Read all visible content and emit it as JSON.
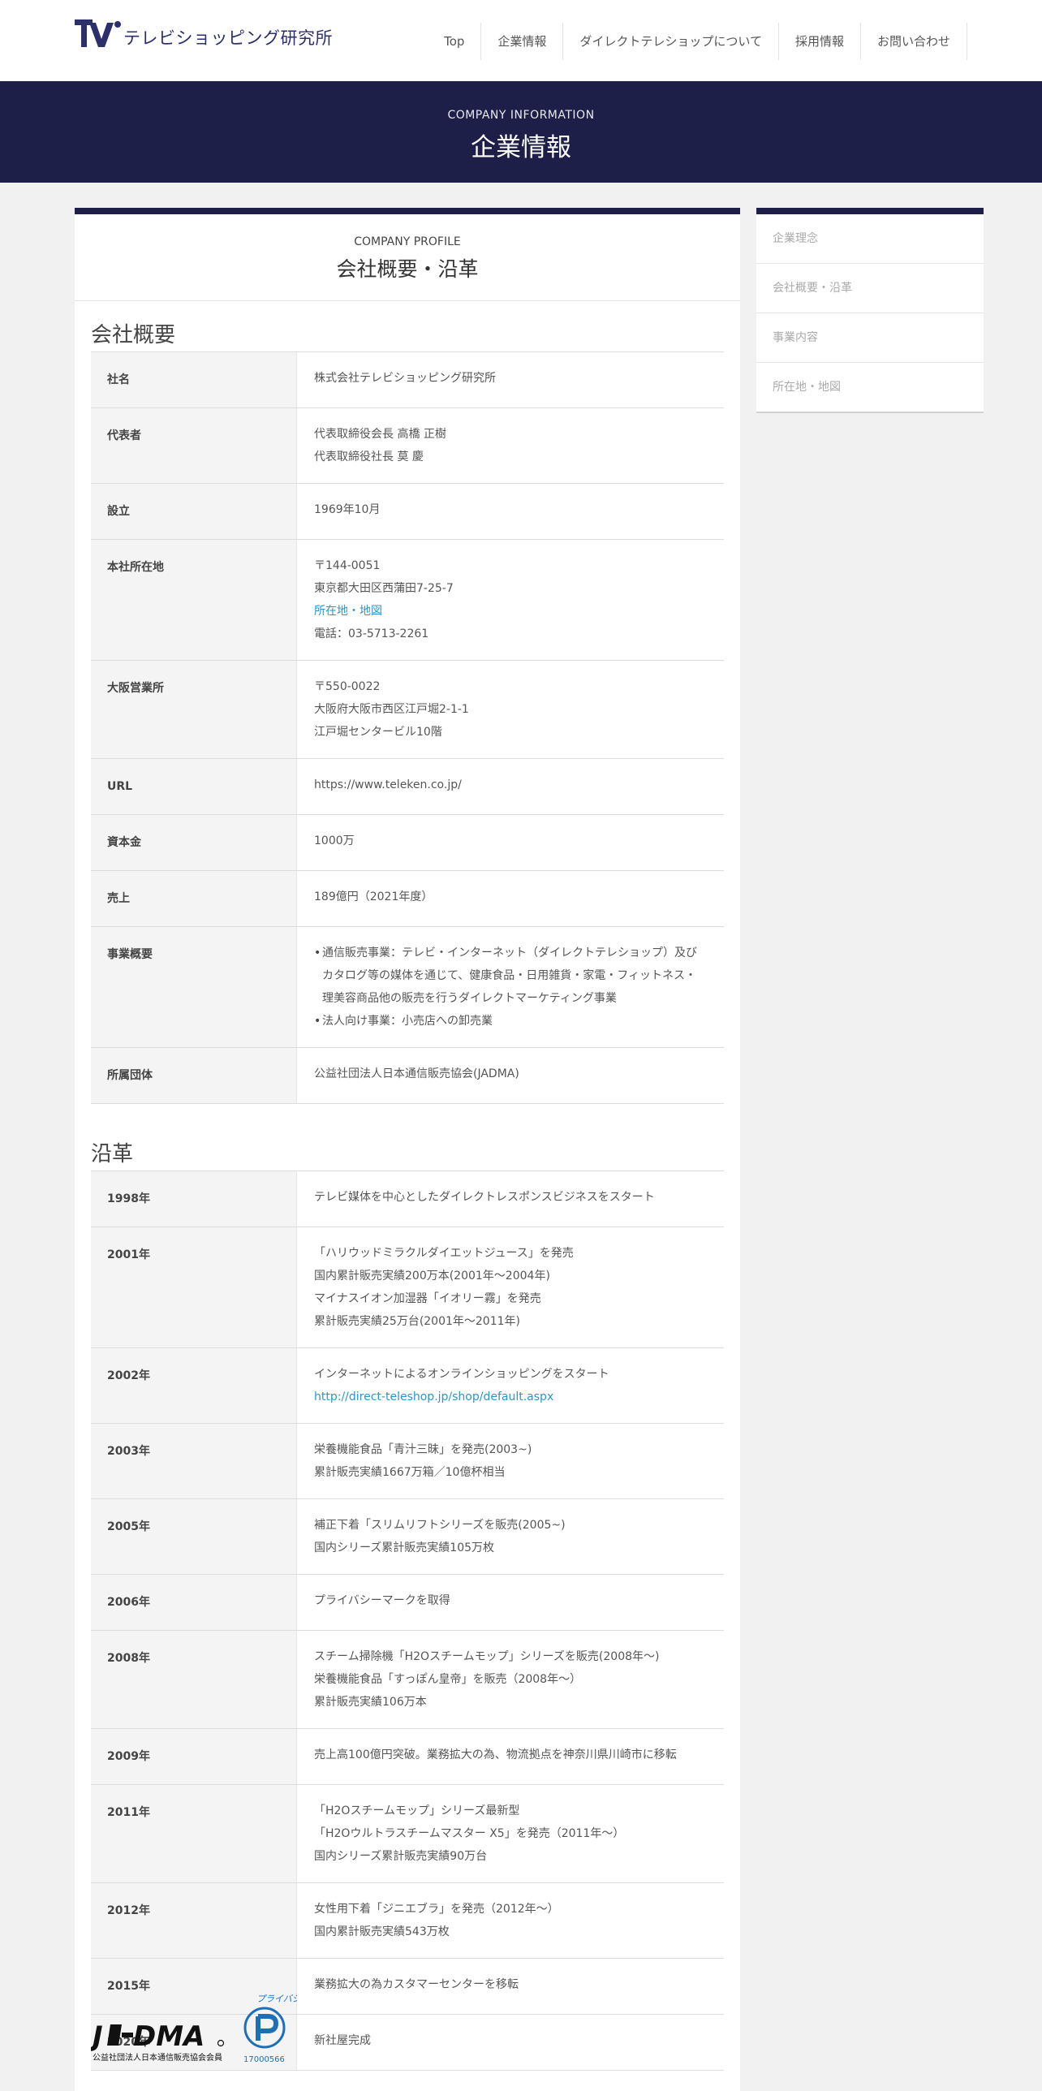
{
  "header": {
    "logo_text": "テレビショッピング研究所",
    "nav": [
      "Top",
      "企業情報",
      "ダイレクトテレショップについて",
      "採用情報",
      "お問い合わせ"
    ]
  },
  "hero": {
    "subtitle": "COMPANY INFORMATION",
    "title": "企業情報"
  },
  "profile": {
    "subtitle": "COMPANY PROFILE",
    "title": "会社概要・沿革"
  },
  "overview": {
    "heading": "会社概要",
    "rows": [
      {
        "label": "社名",
        "lines": [
          "株式会社テレビショッピング研究所"
        ]
      },
      {
        "label": "代表者",
        "lines": [
          "代表取締役会長 高橋 正樹",
          "代表取締役社長 莫 慶"
        ]
      },
      {
        "label": "設立",
        "lines": [
          "1969年10月"
        ]
      },
      {
        "label": "本社所在地",
        "lines": [
          "〒144-0051",
          "東京都大田区西蒲田7-25-7"
        ],
        "link": "所在地・地図",
        "after": [
          "電話：03-5713-2261"
        ]
      },
      {
        "label": "大阪営業所",
        "lines": [
          "〒550-0022",
          "大阪府大阪市西区江戸堀2-1-1",
          "江戸堀センタービル10階"
        ]
      },
      {
        "label": "URL",
        "lines": [
          "https://www.teleken.co.jp/"
        ]
      },
      {
        "label": "資本金",
        "lines": [
          "1000万"
        ]
      },
      {
        "label": "売上",
        "lines": [
          "189億円（2021年度）"
        ]
      },
      {
        "label": "事業概要",
        "bullets": [
          "通信販売事業：テレビ・インターネット（ダイレクトテレショップ）及びカタログ等の媒体を通じて、健康食品・日用雑貨・家電・フィットネス・理美容商品他の販売を行うダイレクトマーケティング事業",
          "法人向け事業：小売店への卸売業"
        ]
      },
      {
        "label": "所属団体",
        "lines": [
          "公益社団法人日本通信販売協会(JADMA)"
        ]
      }
    ]
  },
  "history": {
    "heading": "沿革",
    "rows": [
      {
        "label": "1998年",
        "lines": [
          "テレビ媒体を中心としたダイレクトレスポンスビジネスをスタート"
        ]
      },
      {
        "label": "2001年",
        "lines": [
          "「ハリウッドミラクルダイエットジュース」を発売",
          "国内累計販売実績200万本(2001年〜2004年)",
          "マイナスイオン加湿器「イオリー霧」を発売",
          "累計販売実績25万台(2001年〜2011年)"
        ]
      },
      {
        "label": "2002年",
        "lines": [
          "インターネットによるオンラインショッピングをスタート"
        ],
        "link": "http://direct-teleshop.jp/shop/default.aspx"
      },
      {
        "label": "2003年",
        "lines": [
          "栄養機能食品「青汁三昧」を発売(2003~)",
          "累計販売実績1667万箱／10億杯相当"
        ]
      },
      {
        "label": "2005年",
        "lines": [
          "補正下着「スリムリフトシリーズを販売(2005~)",
          "国内シリーズ累計販売実績105万枚"
        ]
      },
      {
        "label": "2006年",
        "lines": [
          "プライバシーマークを取得"
        ]
      },
      {
        "label": "2008年",
        "lines": [
          "スチーム掃除機「H2Oスチームモップ」シリーズを販売(2008年〜)",
          "栄養機能食品「すっぽん皇帝」を販売（2008年〜）",
          "累計販売実績106万本"
        ]
      },
      {
        "label": "2009年",
        "lines": [
          "売上高100億円突破。業務拡大の為、物流拠点を神奈川県川崎市に移転"
        ]
      },
      {
        "label": "2011年",
        "lines": [
          "「H2Oスチームモップ」シリーズ最新型",
          "「H2Oウルトラスチームマスター X5」を発売（2011年〜）",
          "国内シリーズ累計販売実績90万台"
        ]
      },
      {
        "label": "2012年",
        "lines": [
          "女性用下着「ジニエブラ」を発売（2012年〜）",
          "国内累計販売実績543万枚"
        ]
      },
      {
        "label": "2015年",
        "lines": [
          "業務拡大の為カスタマーセンターを移転"
        ]
      },
      {
        "label": "2020年",
        "lines": [
          "新社屋完成"
        ]
      }
    ]
  },
  "sidebar": {
    "items": [
      "企業理念",
      "会社概要・沿革",
      "事業内容",
      "所在地・地図"
    ]
  },
  "footer": {
    "jadma_caption": "公益社団法人日本通信販売協会会員",
    "pmark_text": "プライバシー",
    "pmark_number": "17000566"
  },
  "colors": {
    "navy": "#1e1f48",
    "link": "#2a96c9"
  }
}
